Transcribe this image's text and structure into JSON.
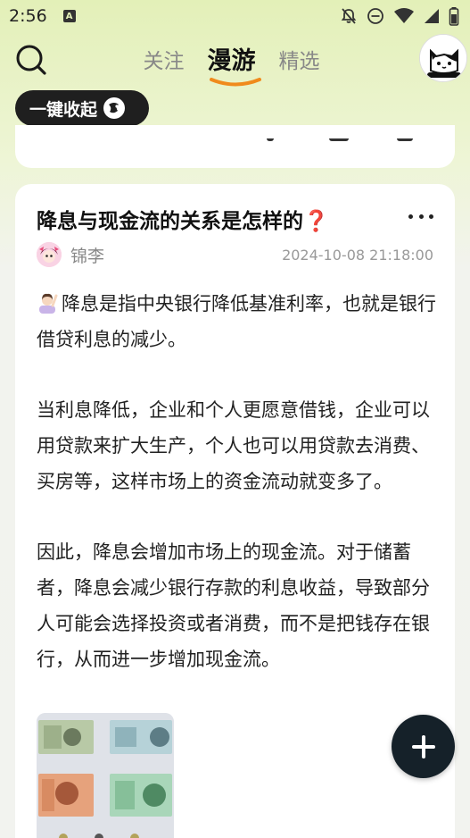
{
  "status_bar": {
    "time": "2:56",
    "notification_letter": "A"
  },
  "nav": {
    "tabs": [
      {
        "label": "关注",
        "active": false
      },
      {
        "label": "漫游",
        "active": true
      },
      {
        "label": "精选",
        "active": false
      }
    ]
  },
  "collapse_button": {
    "label": "一键收起"
  },
  "post": {
    "title": "降息与现金流的关系是怎样的❓",
    "author": "锦李",
    "timestamp": "2024-10-08 21:18:00",
    "paragraphs": [
      "降息是指中央银行降低基准利率，也就是银行借贷利息的减少。",
      "当利息降低，企业和个人更愿意借钱，企业可以用贷款来扩大生产，个人也可以用贷款去消费、买房等，这样市场上的资金流动就变多了。",
      "因此，降息会增加市场上的现金流。对于储蓄者，降息会减少银行存款的利息收益，导致部分人可能会选择投资或者消费，而不是把钱存在银行，从而进一步增加现金流。"
    ],
    "image_alt_icon": "banknotes-image"
  },
  "colors": {
    "accent": "#f08a1c",
    "fab": "#152129",
    "background_top": "#e3f0b8"
  }
}
